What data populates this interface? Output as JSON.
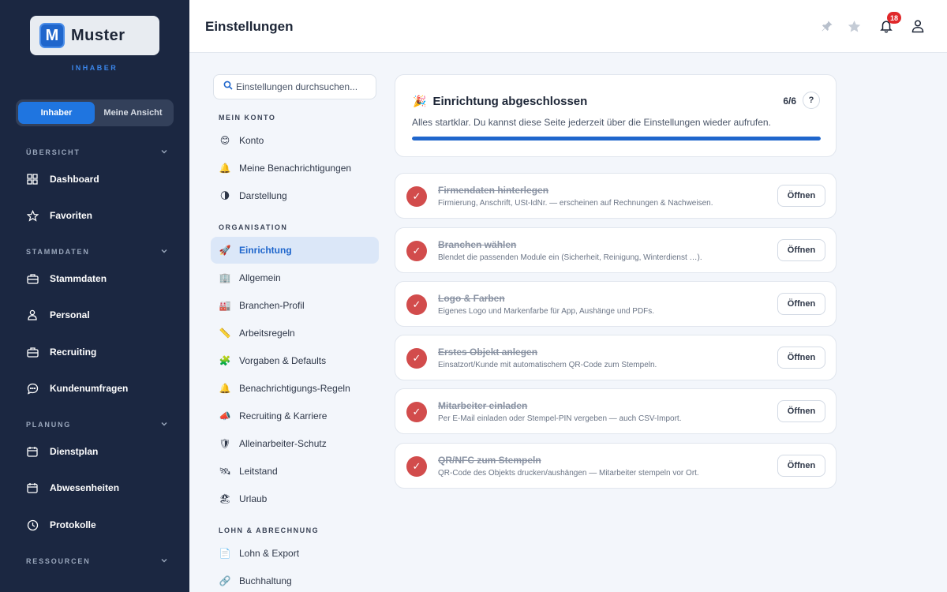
{
  "brand": {
    "name": "Muster",
    "logo_letter": "M",
    "role": "INHABER"
  },
  "view_toggle": {
    "owner": "Inhaber",
    "mine": "Meine Ansicht"
  },
  "sidebar": {
    "sections": {
      "overview": "ÜBERSICHT",
      "master": "STAMMDATEN",
      "planning": "PLANUNG",
      "resources": "RESSOURCEN"
    },
    "items": {
      "dashboard": "Dashboard",
      "favorites": "Favoriten",
      "masterdata": "Stammdaten",
      "staff": "Personal",
      "recruiting": "Recruiting",
      "surveys": "Kundenumfragen",
      "roster": "Dienstplan",
      "absences": "Abwesenheiten",
      "logs": "Protokolle"
    }
  },
  "header": {
    "title": "Einstellungen",
    "notification_count": "18"
  },
  "settings_nav": {
    "search_placeholder": "Einstellungen durchsuchen...",
    "sections": {
      "account": "MEIN KONTO",
      "organisation": "ORGANISATION",
      "payroll": "LOHN & ABRECHNUNG"
    },
    "items": {
      "konto": "Konto",
      "benachrichtigungen": "Meine Benachrichtigungen",
      "darstellung": "Darstellung",
      "einrichtung": "Einrichtung",
      "allgemein": "Allgemein",
      "branchen": "Branchen-Profil",
      "arbeitsregeln": "Arbeitsregeln",
      "vorgaben": "Vorgaben & Defaults",
      "benach_regeln": "Benachrichtigungs-Regeln",
      "recruiting": "Recruiting & Karriere",
      "alleinarbeiter": "Alleinarbeiter-Schutz",
      "leitstand": "Leitstand",
      "urlaub": "Urlaub",
      "lohn": "Lohn & Export",
      "buchhaltung": "Buchhaltung"
    }
  },
  "setup": {
    "title": "Einrichtung abgeschlossen",
    "count": "6/6",
    "help": "?",
    "description": "Alles startklar. Du kannst diese Seite jederzeit über die Einstellungen wieder aufrufen.",
    "progress_percent": 100,
    "open_label": "Öffnen",
    "tasks": [
      {
        "title": "Firmendaten hinterlegen",
        "description": "Firmierung, Anschrift, USt-IdNr. — erscheinen auf Rechnungen & Nachweisen."
      },
      {
        "title": "Branchen wählen",
        "description": "Blendet die passenden Module ein (Sicherheit, Reinigung, Winterdienst …)."
      },
      {
        "title": "Logo & Farben",
        "description": "Eigenes Logo und Markenfarbe für App, Aushänge und PDFs."
      },
      {
        "title": "Erstes Objekt anlegen",
        "description": "Einsatzort/Kunde mit automatischem QR-Code zum Stempeln."
      },
      {
        "title": "Mitarbeiter einladen",
        "description": "Per E-Mail einladen oder Stempel-PIN vergeben — auch CSV-Import."
      },
      {
        "title": "QR/NFC zum Stempeln",
        "description": "QR-Code des Objekts drucken/aushängen — Mitarbeiter stempeln vor Ort."
      }
    ]
  },
  "colors": {
    "sidebar_bg": "#1b2741",
    "accent": "#1f66cc",
    "check": "#d24c4c",
    "badge": "#e0282a"
  }
}
